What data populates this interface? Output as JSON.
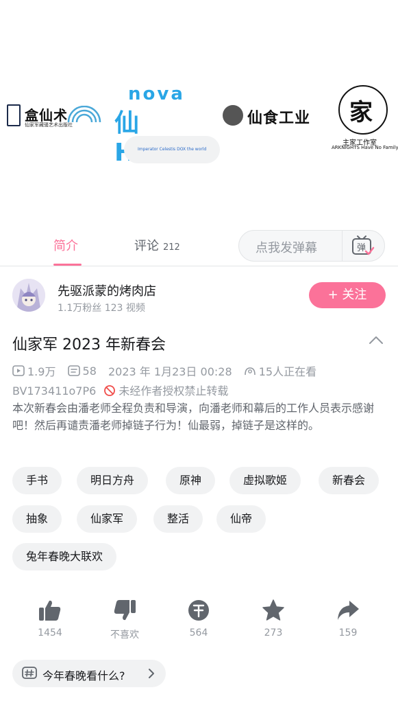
{
  "banner": {
    "logo1_title": "盒仙术",
    "logo1_sub": "仙家军藏骚艺术出版社",
    "logo2_top": "nova",
    "logo2_main": "仙HoYo",
    "logo2_tag": "Imperator Celestis DOX the world",
    "logo3_title": "仙食工业",
    "logo4_glyph": "家",
    "logo4_line1": "主家工作室",
    "logo4_line2": "ARKNIGHTS Have No Family"
  },
  "tabs": {
    "intro": "简介",
    "comments": "评论",
    "comments_count": "212",
    "danmu_placeholder": "点我发弹幕"
  },
  "uploader": {
    "name": "先驱派蒙的烤肉店",
    "stats": "1.1万粉丝  123 视频",
    "follow_label": "+ 关注"
  },
  "video": {
    "title": "仙家军 2023 年新春会",
    "views": "1.9万",
    "danmaku": "58",
    "date": "2023 年 1月23日 00:28",
    "watching": "15人正在看",
    "bvid": "BV173411o7P6",
    "no_repost": "未经作者授权禁止转载",
    "description": "本次新春会由潘老师全程负责和导演，向潘老师和幕后的工作人员表示感谢吧！然后再谴责潘老师掉链子行为！仙最弱，掉链子是这样的。"
  },
  "tags": [
    "手书",
    "明日方舟",
    "原神",
    "虚拟歌姬",
    "新春会",
    "抽象",
    "仙家军",
    "整活",
    "仙帝",
    "兔年春晚大联欢"
  ],
  "actions": {
    "like": "1454",
    "dislike": "不喜欢",
    "coin": "564",
    "favorite": "273",
    "share": "159"
  },
  "topic": {
    "label": "今年春晚看什么?"
  },
  "colors": {
    "accent": "#fb7299",
    "muted": "#9499a0",
    "icon": "#61666d"
  }
}
